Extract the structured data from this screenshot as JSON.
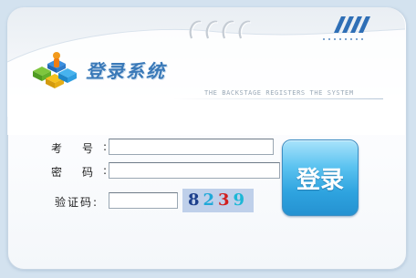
{
  "header": {
    "title": "登录系统",
    "subtitle": "THE BACKSTAGE REGISTERS THE SYSTEM"
  },
  "form": {
    "exam_no_label": "考号",
    "password_label": "密码",
    "captcha_label": "验证码:",
    "colon": ":",
    "exam_no_value": "",
    "password_value": "",
    "captcha_value": "",
    "captcha_code": [
      "8",
      "2",
      "3",
      "9"
    ],
    "login_button": "登录"
  },
  "colors": {
    "title": "#3a79b8",
    "button": "#2ea3df",
    "captcha_bg": "#bfd0ea"
  }
}
